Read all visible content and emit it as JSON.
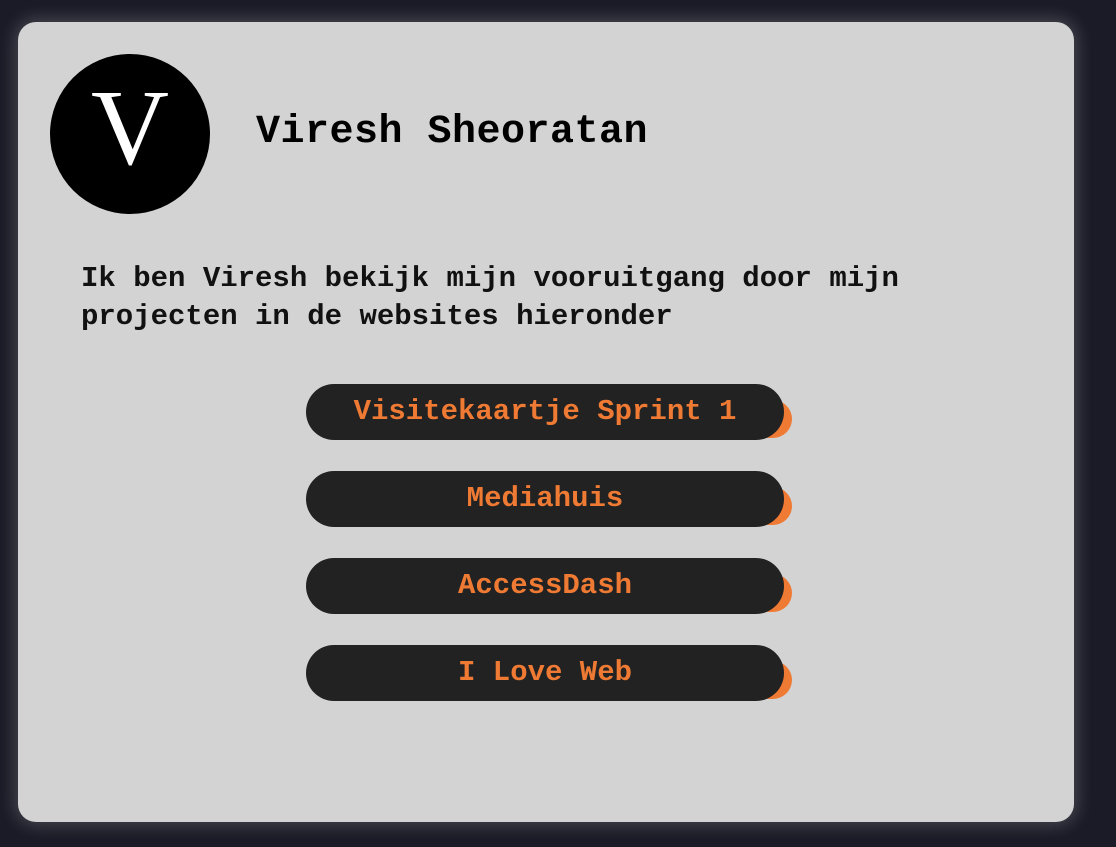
{
  "profile": {
    "logo_letter": "V",
    "name": "Viresh Sheoratan",
    "intro": "Ik ben Viresh bekijk mijn vooruitgang door mijn projecten in de websites hieronder"
  },
  "links": [
    {
      "label": "Visitekaartje Sprint 1"
    },
    {
      "label": "Mediahuis"
    },
    {
      "label": "AccessDash"
    },
    {
      "label": "I Love Web"
    }
  ],
  "colors": {
    "background": "#1b1b27",
    "card": "#d3d3d3",
    "button": "#222222",
    "accent": "#ef7a33"
  }
}
